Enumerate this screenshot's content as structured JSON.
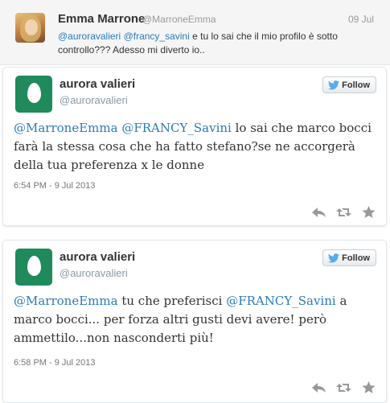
{
  "reply_tweet": {
    "name": "Emma Marrone",
    "handle": "@MarroneEmma",
    "date": "09 Jul",
    "mention_1": "@auroravalieri",
    "mention_2": "@francy_savini",
    "text_line": " e tu lo sai che il mio profilo è sotto controllo??? Adesso mi diverto io.."
  },
  "tweets": [
    {
      "name": "aurora valieri",
      "handle": "@auroravalieri",
      "follow_label": "Follow",
      "mention_1": "@MarroneEmma",
      "mention_2": "@FRANCY_Savini",
      "text": " lo sai che marco bocci farà la stessa cosa che ha fatto stefano?se ne accorgerà della tua preferenza x le donne",
      "timestamp": "6:54 PM - 9 Jul 2013"
    },
    {
      "name": "aurora valieri",
      "handle": "@auroravalieri",
      "follow_label": "Follow",
      "mention_1": "@MarroneEmma",
      "text_mid": "  tu che preferisci ",
      "mention_2": "@FRANCY_Savini",
      "text": "  a marco bocci... per forza altri gusti devi avere! però ammettilo...non nasconderti più!",
      "timestamp": "6:58 PM - 9 Jul 2013"
    }
  ],
  "icons": {
    "reply": "reply-icon",
    "retweet": "retweet-icon",
    "favorite": "star-icon",
    "follow": "twitter-bird-icon",
    "avatar": "egg-avatar"
  },
  "colors": {
    "mention": "#2b7bb9",
    "egg_background": "#1f8a5c",
    "action_icon": "#999999"
  }
}
